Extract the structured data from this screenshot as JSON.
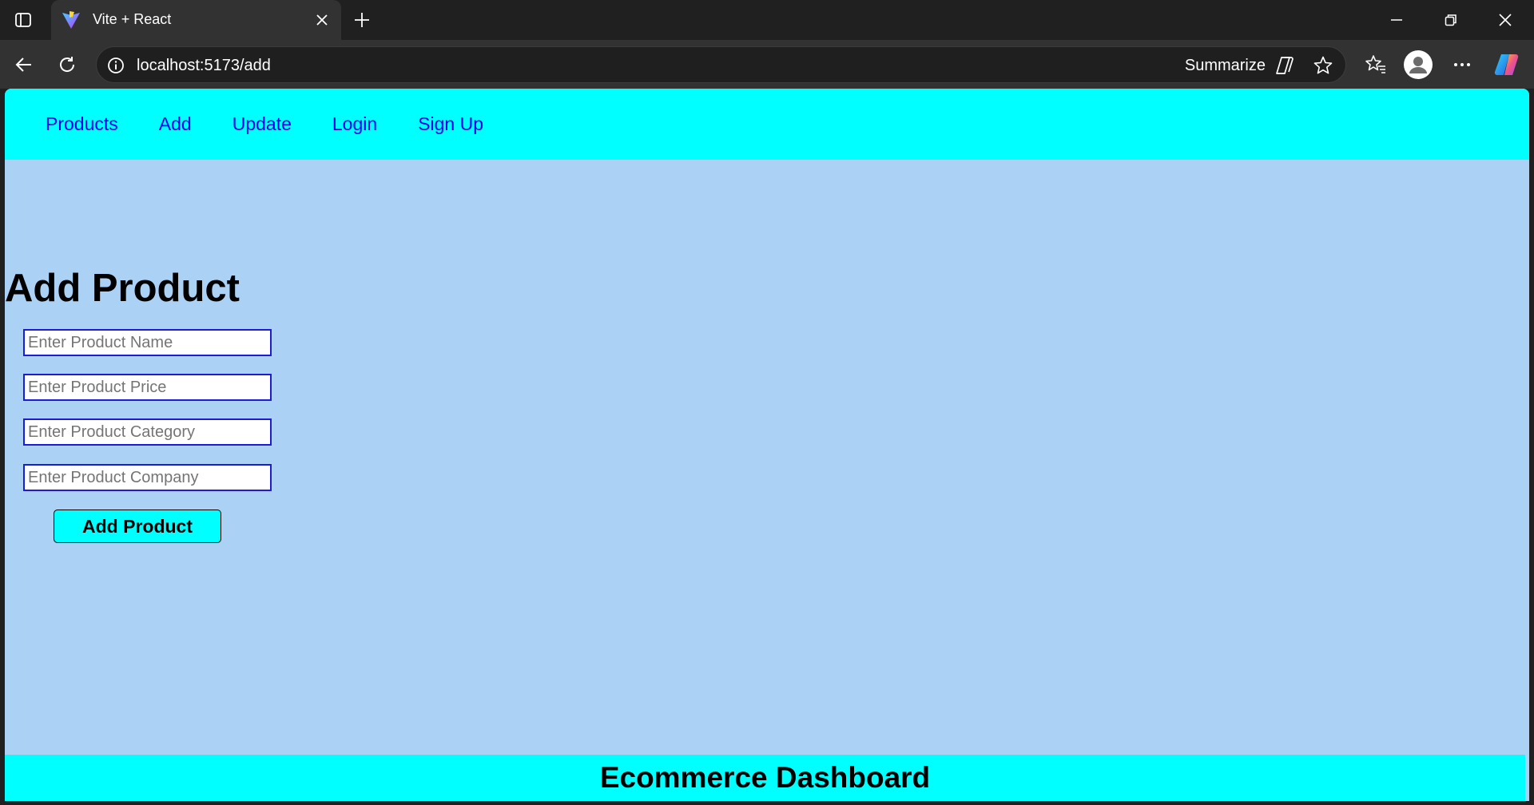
{
  "browser": {
    "tab_title": "Vite + React",
    "url": "localhost:5173/add",
    "summarize_label": "Summarize"
  },
  "nav": {
    "links": [
      "Products",
      "Add",
      "Update",
      "Login",
      "Sign Up"
    ]
  },
  "form": {
    "heading": "Add Product",
    "fields": {
      "name_placeholder": "Enter Product Name",
      "price_placeholder": "Enter Product Price",
      "category_placeholder": "Enter Product Category",
      "company_placeholder": "Enter Product Company"
    },
    "submit_label": "Add Product"
  },
  "footer": {
    "title": "Ecommerce Dashboard"
  },
  "colors": {
    "nav_bg": "#00ffff",
    "page_bg": "#abd1f4",
    "link": "#0000ee",
    "input_border": "#1c1cd6"
  }
}
